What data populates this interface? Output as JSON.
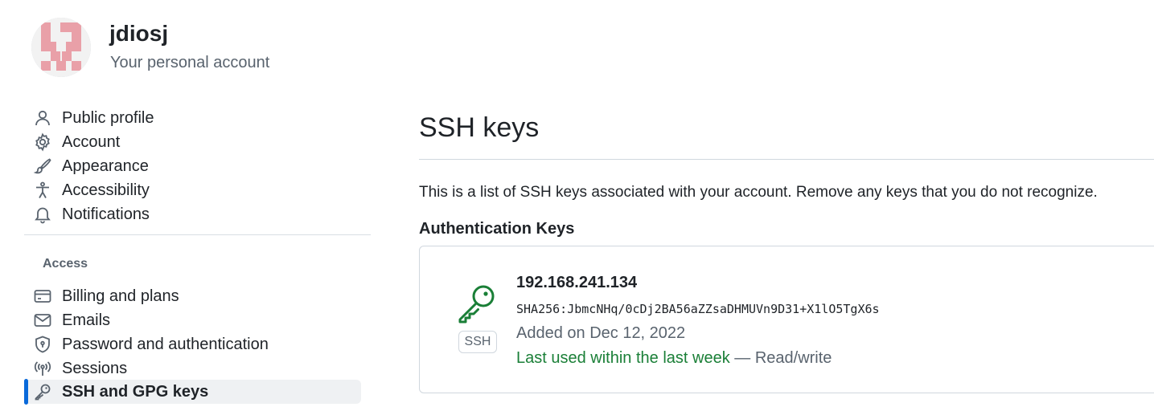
{
  "account": {
    "username": "jdiosj",
    "subtitle": "Your personal account"
  },
  "sidebar": {
    "items": [
      {
        "label": "Public profile",
        "icon": "person-icon"
      },
      {
        "label": "Account",
        "icon": "gear-icon"
      },
      {
        "label": "Appearance",
        "icon": "paintbrush-icon"
      },
      {
        "label": "Accessibility",
        "icon": "accessibility-icon"
      },
      {
        "label": "Notifications",
        "icon": "bell-icon"
      }
    ],
    "access_section_label": "Access",
    "access_items": [
      {
        "label": "Billing and plans",
        "icon": "credit-card-icon"
      },
      {
        "label": "Emails",
        "icon": "mail-icon"
      },
      {
        "label": "Password and authentication",
        "icon": "shield-lock-icon"
      },
      {
        "label": "Sessions",
        "icon": "broadcast-icon"
      },
      {
        "label": "SSH and GPG keys",
        "icon": "key-icon",
        "active": true
      }
    ]
  },
  "main": {
    "title": "SSH keys",
    "description": "This is a list of SSH keys associated with your account. Remove any keys that you do not recognize.",
    "auth_heading": "Authentication Keys",
    "key": {
      "title": "192.168.241.134",
      "fingerprint": "SHA256:JbmcNHq/0cDj2BA56aZZsaDHMUVn9D31+X1lO5TgX6s",
      "added": "Added on Dec 12, 2022",
      "last_used": "Last used within the last week",
      "separator": " — ",
      "access": "Read/write",
      "badge": "SSH"
    }
  },
  "colors": {
    "accent": "#0969da",
    "success": "#1a7f37",
    "muted": "#59636e",
    "avatar_pink": "#e9a0a8"
  }
}
